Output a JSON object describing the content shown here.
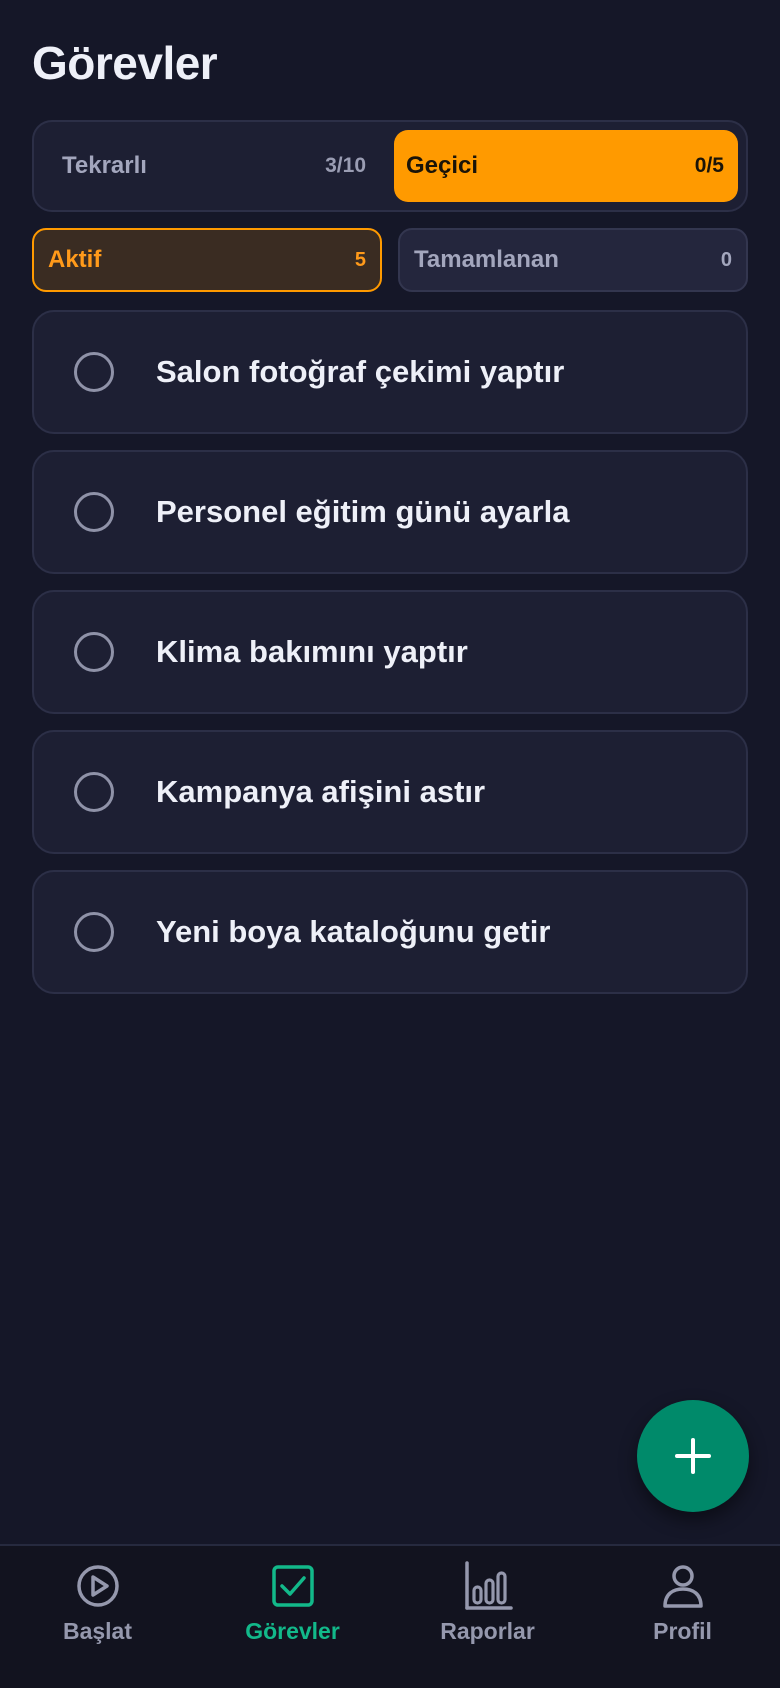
{
  "page": {
    "title": "Görevler"
  },
  "segments": [
    {
      "label": "Tekrarlı",
      "count": "3/10",
      "selected": false
    },
    {
      "label": "Geçici",
      "count": "0/5",
      "selected": true
    }
  ],
  "filters": [
    {
      "label": "Aktif",
      "count": "5",
      "selected": true
    },
    {
      "label": "Tamamlanan",
      "count": "0",
      "selected": false
    }
  ],
  "tasks": [
    {
      "title": "Salon fotoğraf çekimi yaptır",
      "done": false
    },
    {
      "title": "Personel eğitim günü ayarla",
      "done": false
    },
    {
      "title": "Klima bakımını yaptır",
      "done": false
    },
    {
      "title": "Kampanya afişini astır",
      "done": false
    },
    {
      "title": "Yeni boya kataloğunu getir",
      "done": false
    }
  ],
  "fab": {
    "icon": "plus-icon"
  },
  "nav": [
    {
      "label": "Başlat",
      "icon": "play-circle-icon",
      "active": false
    },
    {
      "label": "Görevler",
      "icon": "checkbox-icon",
      "active": true
    },
    {
      "label": "Raporlar",
      "icon": "bar-chart-icon",
      "active": false
    },
    {
      "label": "Profil",
      "icon": "user-icon",
      "active": false
    }
  ],
  "colors": {
    "background": "#151728",
    "accent_orange": "#ff9a00",
    "accent_green": "#12b98a",
    "fab_green": "#008a6a"
  }
}
